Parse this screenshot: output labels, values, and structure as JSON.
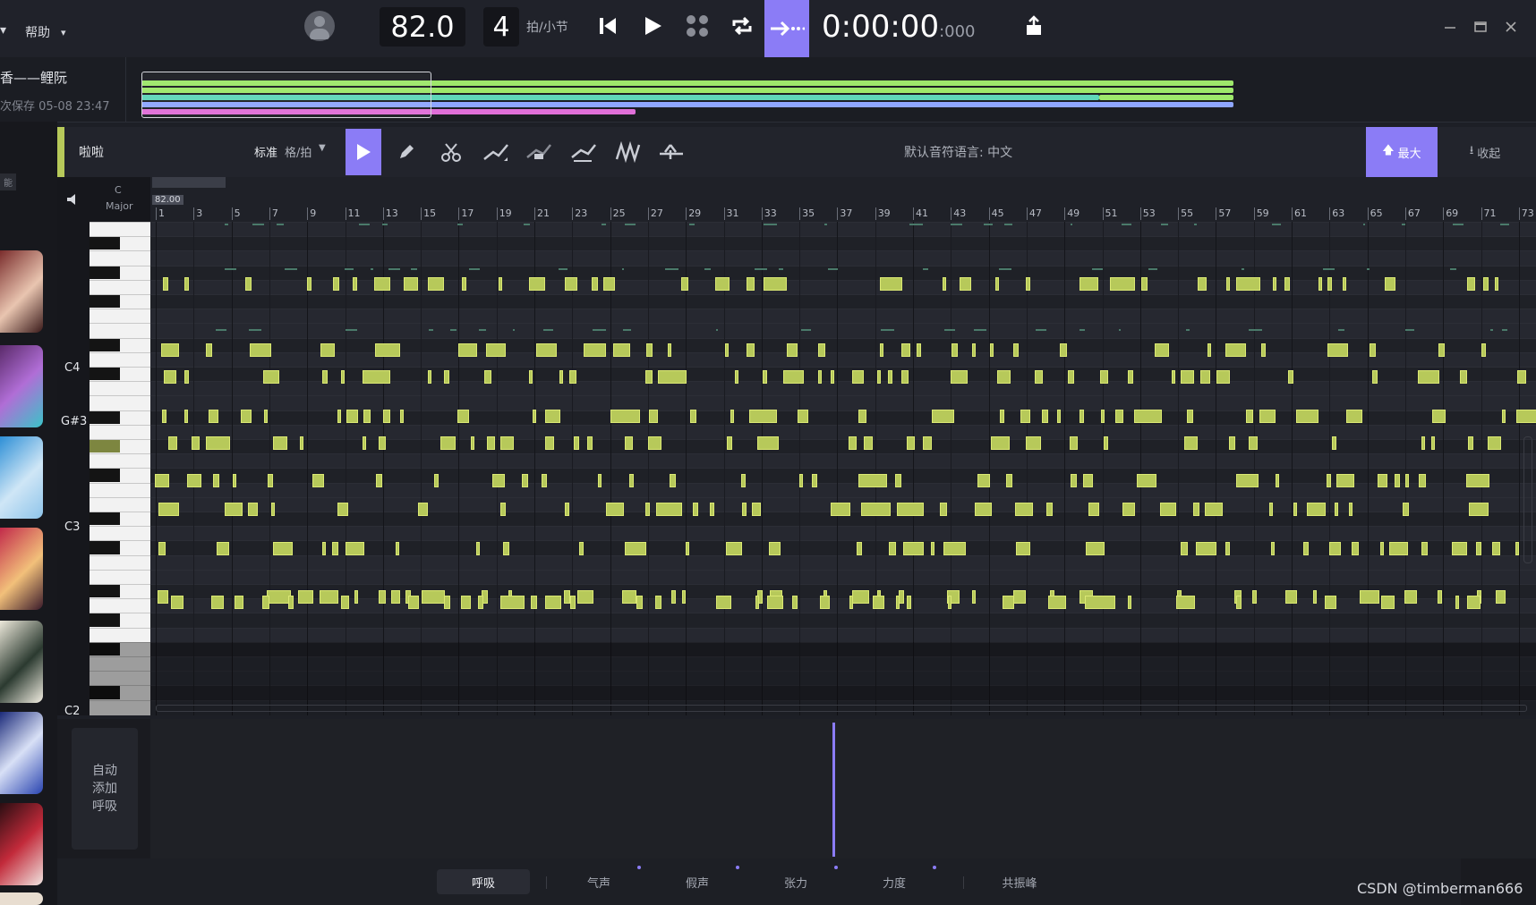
{
  "app": {
    "menu_left_arrow": "▾",
    "menu_help": "帮助",
    "menu_help_arrow": "▾"
  },
  "transport": {
    "tempo": "82.0",
    "beats": "4",
    "beats_unit": "拍/小节",
    "time_main": "0:00:00",
    "time_ms": ":000"
  },
  "project": {
    "title": "香——鲤阮",
    "saved": "次保存 05-08 23:47"
  },
  "track": {
    "name": "啦啦",
    "quantize_mode": "标准",
    "quantize_value": "格/拍",
    "default_language": "默认音符语言: 中文",
    "max_button": "最大",
    "collapse_button": "收起",
    "key_top": "C",
    "key_bottom": "Major",
    "side_label": "能"
  },
  "ruler": {
    "tempo_marker": "82.00",
    "bars": [
      "1",
      "3",
      "5",
      "7",
      "9",
      "11",
      "13",
      "15",
      "17",
      "19",
      "21",
      "23",
      "25",
      "27",
      "29",
      "31",
      "33",
      "35",
      "37",
      "39",
      "41",
      "43",
      "45",
      "47",
      "49",
      "51",
      "53",
      "55",
      "57",
      "59",
      "61",
      "63",
      "65",
      "67",
      "69",
      "71",
      "73"
    ]
  },
  "piano": {
    "label_c4": "C4",
    "label_gs3": "G#3",
    "label_c3": "C3",
    "label_c2": "C2"
  },
  "params": {
    "auto_breath": "自动添加呼吸",
    "tabs": [
      "呼吸",
      "气声",
      "假声",
      "张力",
      "力度",
      "共振峰"
    ],
    "active_tab": "呼吸"
  },
  "watermark": "CSDN @timberman666",
  "colors": {
    "accent": "#8b7cf6",
    "note": "#b7c95a",
    "note_border": "#dbe874",
    "track_green": "#9ee86b",
    "track_cyan": "#5fd6b9",
    "track_blue": "#8fa6ff",
    "track_pink": "#e06fd8"
  }
}
